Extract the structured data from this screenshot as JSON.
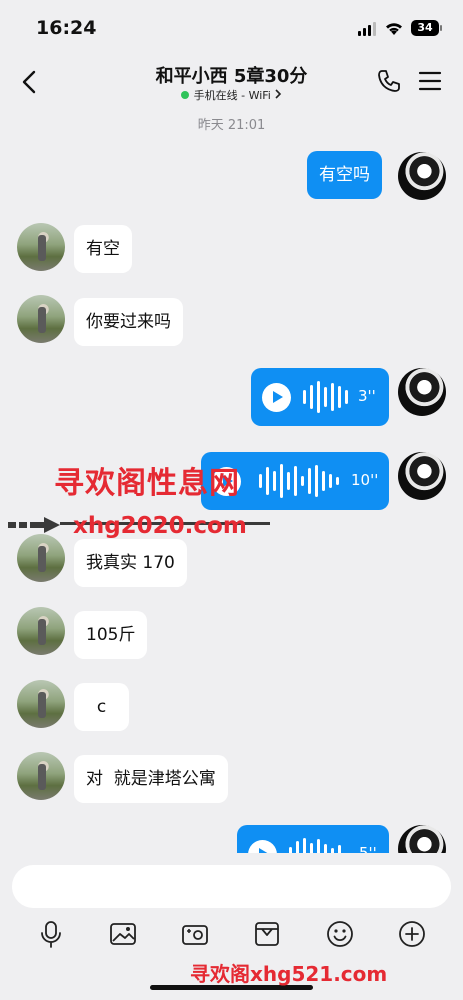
{
  "status_bar": {
    "time": "16:24",
    "battery": "34"
  },
  "header": {
    "title": "和平小西 5章30分",
    "status": "手机在线 - WiFi",
    "status_color": "#2fc35a"
  },
  "chat": {
    "date_separator": "昨天 21:01",
    "messages": [
      {
        "from": "me",
        "type": "text",
        "text": "有空吗"
      },
      {
        "from": "her",
        "type": "text",
        "text": "有空"
      },
      {
        "from": "her",
        "type": "text",
        "text": "你要过来吗"
      },
      {
        "from": "me",
        "type": "voice",
        "duration": "3''"
      },
      {
        "from": "me",
        "type": "voice",
        "duration": "10''"
      },
      {
        "from": "her",
        "type": "text",
        "text": "我真实 170"
      },
      {
        "from": "her",
        "type": "text",
        "text": "105斤"
      },
      {
        "from": "her",
        "type": "text",
        "text": "c"
      },
      {
        "from": "her",
        "type": "text",
        "text": "对  就是津塔公寓"
      },
      {
        "from": "me",
        "type": "voice",
        "duration": "5''"
      }
    ]
  },
  "watermarks": {
    "line1": "寻欢阁性息网",
    "line2": "xhg2020.com",
    "line3": "寻欢阁xhg521.com"
  },
  "toolbar": [
    "mic-icon",
    "image-icon",
    "camera-icon",
    "file-icon",
    "emoji-icon",
    "plus-icon"
  ],
  "colors": {
    "bubble_out": "#0f8ff3",
    "bubble_in": "#ffffff",
    "background": "#efeff1",
    "watermark": "#e52a33"
  }
}
